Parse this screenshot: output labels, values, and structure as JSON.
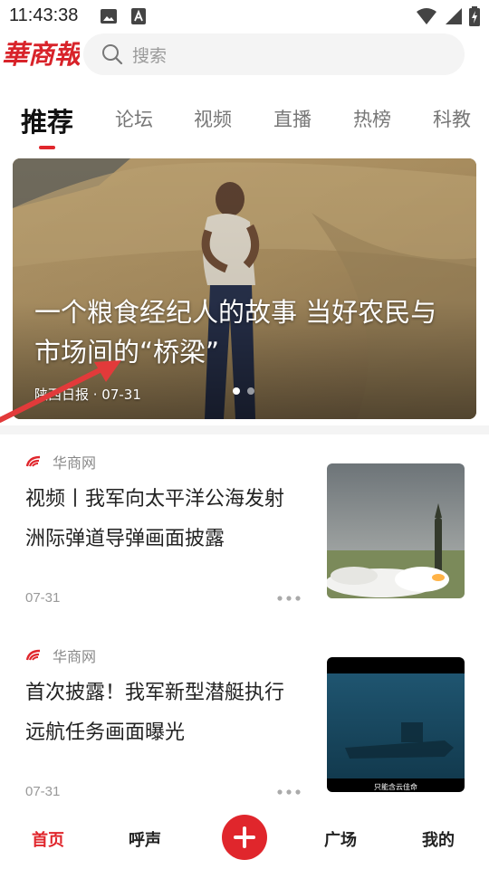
{
  "status_bar": {
    "time": "11:43:38",
    "icons": [
      "image-icon",
      "a-icon",
      "wifi-icon",
      "signal-icon",
      "battery-icon"
    ]
  },
  "header": {
    "logo_text": "華商報",
    "search_placeholder": "搜索"
  },
  "tabs": [
    {
      "label": "推荐",
      "active": true
    },
    {
      "label": "论坛",
      "active": false
    },
    {
      "label": "视频",
      "active": false
    },
    {
      "label": "直播",
      "active": false
    },
    {
      "label": "热榜",
      "active": false
    },
    {
      "label": "科教",
      "active": false
    }
  ],
  "banner": {
    "title": "一个粮食经纪人的故事 当好农民与市场间的“桥梁”",
    "source": "陕西日报",
    "date": "07-31",
    "meta": "陕西日报 · 07-31",
    "slide_count": 2,
    "active_slide": 1
  },
  "news": [
    {
      "source": "华商网",
      "title": "视频丨我军向太平洋公海发射洲际弹道导弹画面披露",
      "date": "07-31",
      "thumb_icon": "missile-launch-image"
    },
    {
      "source": "华商网",
      "title": "首次披露！我军新型潜艇执行远航任务画面曝光",
      "date": "07-31",
      "thumb_icon": "submarine-image",
      "thumb_caption": "只能含云佳命"
    }
  ],
  "bottom_nav": [
    {
      "label": "首页",
      "active": true
    },
    {
      "label": "呼声",
      "active": false
    },
    {
      "label": "广场",
      "active": false
    },
    {
      "label": "我的",
      "active": false
    }
  ],
  "colors": {
    "accent": "#e0262c",
    "text": "#222222",
    "muted": "#999999",
    "search_bg": "#f4f4f4"
  }
}
